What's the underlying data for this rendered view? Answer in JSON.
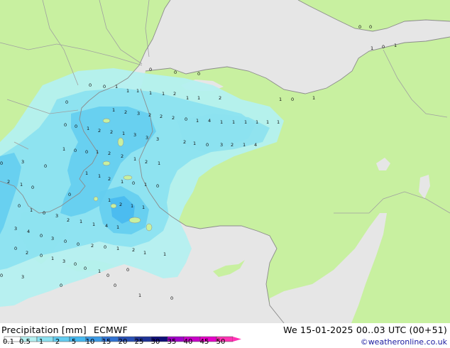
{
  "header": {
    "title": "Precipitation [mm]",
    "model": "ECMWF",
    "datetime": "We 15-01-2025 00..03 UTC (00+51)",
    "credit": "©weatheronline.co.uk"
  },
  "legend": {
    "labels": [
      "0.1",
      "0.5",
      "1",
      "2",
      "5",
      "10",
      "15",
      "20",
      "25",
      "30",
      "35",
      "40",
      "45",
      "50"
    ],
    "colors": [
      "#ffffff",
      "#b4f0f0",
      "#8ce1f0",
      "#64cdf0",
      "#46b9f0",
      "#3c9be6",
      "#3273d2",
      "#2850b4",
      "#1e3296",
      "#0f0f78",
      "#a000c8",
      "#c800c8",
      "#e600c8",
      "#ff32b4"
    ]
  },
  "colors": {
    "land": "#c8f0a0",
    "sea": "#e6e6e6",
    "border": "#a0a0a0",
    "coast": "#8c8c8c",
    "light_precip": "#b4f0f0",
    "mid_precip": "#8ce1f0",
    "heavy_precip": "#64cdf0"
  },
  "values": [
    {
      "v": "0"
    },
    {
      "v": "0"
    },
    {
      "v": "1"
    },
    {
      "v": "0"
    },
    {
      "v": "1"
    },
    {
      "v": "0"
    },
    {
      "v": "0"
    },
    {
      "v": "0"
    },
    {
      "v": "0"
    },
    {
      "v": "0"
    },
    {
      "v": "1"
    },
    {
      "v": "1"
    },
    {
      "v": "0"
    },
    {
      "v": "0"
    },
    {
      "v": "1"
    },
    {
      "v": "1"
    },
    {
      "v": "1"
    },
    {
      "v": "1"
    },
    {
      "v": "2"
    },
    {
      "v": "1"
    },
    {
      "v": "1"
    },
    {
      "v": "2"
    },
    {
      "v": "1"
    },
    {
      "v": "1"
    },
    {
      "v": "2"
    },
    {
      "v": "3"
    },
    {
      "v": "2"
    },
    {
      "v": "2"
    },
    {
      "v": "2"
    },
    {
      "v": "0"
    },
    {
      "v": "1"
    },
    {
      "v": "4"
    },
    {
      "v": "1"
    },
    {
      "v": "1"
    },
    {
      "v": "1"
    },
    {
      "v": "1"
    },
    {
      "v": "1"
    },
    {
      "v": "1"
    },
    {
      "v": "0"
    },
    {
      "v": "0"
    },
    {
      "v": "1"
    },
    {
      "v": "2"
    },
    {
      "v": "2"
    },
    {
      "v": "1"
    },
    {
      "v": "3"
    },
    {
      "v": "3"
    },
    {
      "v": "3"
    },
    {
      "v": "2"
    },
    {
      "v": "1"
    },
    {
      "v": "0"
    },
    {
      "v": "3"
    },
    {
      "v": "2"
    },
    {
      "v": "1"
    },
    {
      "v": "4"
    },
    {
      "v": "1"
    },
    {
      "v": "0"
    },
    {
      "v": "0"
    },
    {
      "v": "1"
    },
    {
      "v": "2"
    },
    {
      "v": "2"
    },
    {
      "v": "1"
    },
    {
      "v": "2"
    },
    {
      "v": "1"
    },
    {
      "v": "0"
    },
    {
      "v": "3"
    },
    {
      "v": "0"
    },
    {
      "v": "1"
    },
    {
      "v": "1"
    },
    {
      "v": "2"
    },
    {
      "v": "1"
    },
    {
      "v": "0"
    },
    {
      "v": "1"
    },
    {
      "v": "0"
    },
    {
      "v": "2"
    },
    {
      "v": "1"
    },
    {
      "v": "0"
    },
    {
      "v": "0"
    },
    {
      "v": "1"
    },
    {
      "v": "2"
    },
    {
      "v": "1"
    },
    {
      "v": "1"
    },
    {
      "v": "0"
    },
    {
      "v": "1"
    },
    {
      "v": "0"
    },
    {
      "v": "3"
    },
    {
      "v": "2"
    },
    {
      "v": "1"
    },
    {
      "v": "1"
    },
    {
      "v": "4"
    },
    {
      "v": "1"
    },
    {
      "v": "3"
    },
    {
      "v": "4"
    },
    {
      "v": "0"
    },
    {
      "v": "3"
    },
    {
      "v": "0"
    },
    {
      "v": "0"
    },
    {
      "v": "2"
    },
    {
      "v": "0"
    },
    {
      "v": "1"
    },
    {
      "v": "2"
    },
    {
      "v": "1"
    },
    {
      "v": "0"
    },
    {
      "v": "2"
    },
    {
      "v": "0"
    },
    {
      "v": "1"
    },
    {
      "v": "3"
    },
    {
      "v": "0"
    },
    {
      "v": "0"
    },
    {
      "v": "1"
    },
    {
      "v": "0"
    },
    {
      "v": "1"
    },
    {
      "v": "0"
    },
    {
      "v": "3"
    },
    {
      "v": "0"
    },
    {
      "v": "0"
    },
    {
      "v": "0"
    },
    {
      "v": "1"
    },
    {
      "v": "0"
    },
    {
      "v": "0"
    },
    {
      "v": "0"
    },
    {
      "v": "1"
    },
    {
      "v": "0"
    },
    {
      "v": "0"
    },
    {
      "v": "1"
    },
    {
      "v": "1"
    },
    {
      "v": "0"
    },
    {
      "v": "0"
    },
    {
      "v": "0"
    },
    {
      "v": "0"
    },
    {
      "v": "0"
    },
    {
      "v": "0"
    },
    {
      "v": "0"
    }
  ]
}
